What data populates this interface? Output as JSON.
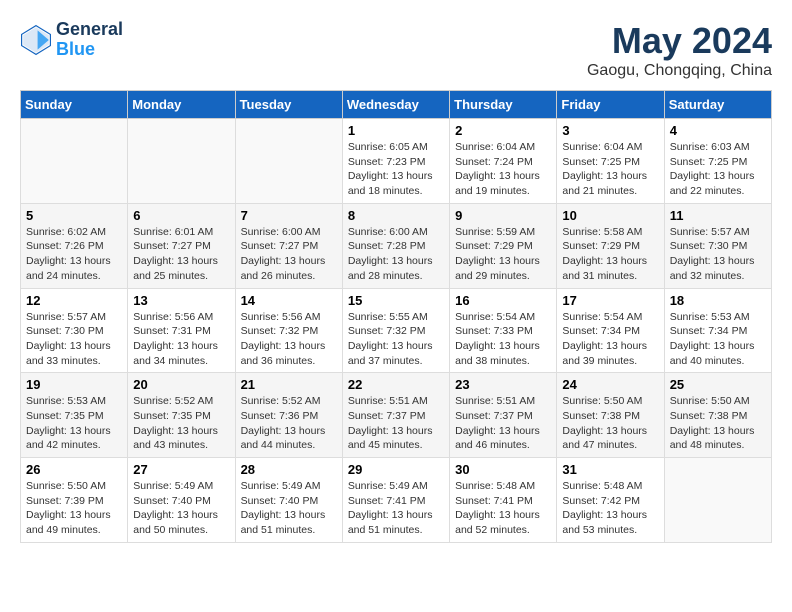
{
  "header": {
    "logo_line1": "General",
    "logo_line2": "Blue",
    "month": "May 2024",
    "location": "Gaogu, Chongqing, China"
  },
  "weekdays": [
    "Sunday",
    "Monday",
    "Tuesday",
    "Wednesday",
    "Thursday",
    "Friday",
    "Saturday"
  ],
  "weeks": [
    [
      {
        "day": "",
        "info": ""
      },
      {
        "day": "",
        "info": ""
      },
      {
        "day": "",
        "info": ""
      },
      {
        "day": "1",
        "info": "Sunrise: 6:05 AM\nSunset: 7:23 PM\nDaylight: 13 hours\nand 18 minutes."
      },
      {
        "day": "2",
        "info": "Sunrise: 6:04 AM\nSunset: 7:24 PM\nDaylight: 13 hours\nand 19 minutes."
      },
      {
        "day": "3",
        "info": "Sunrise: 6:04 AM\nSunset: 7:25 PM\nDaylight: 13 hours\nand 21 minutes."
      },
      {
        "day": "4",
        "info": "Sunrise: 6:03 AM\nSunset: 7:25 PM\nDaylight: 13 hours\nand 22 minutes."
      }
    ],
    [
      {
        "day": "5",
        "info": "Sunrise: 6:02 AM\nSunset: 7:26 PM\nDaylight: 13 hours\nand 24 minutes."
      },
      {
        "day": "6",
        "info": "Sunrise: 6:01 AM\nSunset: 7:27 PM\nDaylight: 13 hours\nand 25 minutes."
      },
      {
        "day": "7",
        "info": "Sunrise: 6:00 AM\nSunset: 7:27 PM\nDaylight: 13 hours\nand 26 minutes."
      },
      {
        "day": "8",
        "info": "Sunrise: 6:00 AM\nSunset: 7:28 PM\nDaylight: 13 hours\nand 28 minutes."
      },
      {
        "day": "9",
        "info": "Sunrise: 5:59 AM\nSunset: 7:29 PM\nDaylight: 13 hours\nand 29 minutes."
      },
      {
        "day": "10",
        "info": "Sunrise: 5:58 AM\nSunset: 7:29 PM\nDaylight: 13 hours\nand 31 minutes."
      },
      {
        "day": "11",
        "info": "Sunrise: 5:57 AM\nSunset: 7:30 PM\nDaylight: 13 hours\nand 32 minutes."
      }
    ],
    [
      {
        "day": "12",
        "info": "Sunrise: 5:57 AM\nSunset: 7:30 PM\nDaylight: 13 hours\nand 33 minutes."
      },
      {
        "day": "13",
        "info": "Sunrise: 5:56 AM\nSunset: 7:31 PM\nDaylight: 13 hours\nand 34 minutes."
      },
      {
        "day": "14",
        "info": "Sunrise: 5:56 AM\nSunset: 7:32 PM\nDaylight: 13 hours\nand 36 minutes."
      },
      {
        "day": "15",
        "info": "Sunrise: 5:55 AM\nSunset: 7:32 PM\nDaylight: 13 hours\nand 37 minutes."
      },
      {
        "day": "16",
        "info": "Sunrise: 5:54 AM\nSunset: 7:33 PM\nDaylight: 13 hours\nand 38 minutes."
      },
      {
        "day": "17",
        "info": "Sunrise: 5:54 AM\nSunset: 7:34 PM\nDaylight: 13 hours\nand 39 minutes."
      },
      {
        "day": "18",
        "info": "Sunrise: 5:53 AM\nSunset: 7:34 PM\nDaylight: 13 hours\nand 40 minutes."
      }
    ],
    [
      {
        "day": "19",
        "info": "Sunrise: 5:53 AM\nSunset: 7:35 PM\nDaylight: 13 hours\nand 42 minutes."
      },
      {
        "day": "20",
        "info": "Sunrise: 5:52 AM\nSunset: 7:35 PM\nDaylight: 13 hours\nand 43 minutes."
      },
      {
        "day": "21",
        "info": "Sunrise: 5:52 AM\nSunset: 7:36 PM\nDaylight: 13 hours\nand 44 minutes."
      },
      {
        "day": "22",
        "info": "Sunrise: 5:51 AM\nSunset: 7:37 PM\nDaylight: 13 hours\nand 45 minutes."
      },
      {
        "day": "23",
        "info": "Sunrise: 5:51 AM\nSunset: 7:37 PM\nDaylight: 13 hours\nand 46 minutes."
      },
      {
        "day": "24",
        "info": "Sunrise: 5:50 AM\nSunset: 7:38 PM\nDaylight: 13 hours\nand 47 minutes."
      },
      {
        "day": "25",
        "info": "Sunrise: 5:50 AM\nSunset: 7:38 PM\nDaylight: 13 hours\nand 48 minutes."
      }
    ],
    [
      {
        "day": "26",
        "info": "Sunrise: 5:50 AM\nSunset: 7:39 PM\nDaylight: 13 hours\nand 49 minutes."
      },
      {
        "day": "27",
        "info": "Sunrise: 5:49 AM\nSunset: 7:40 PM\nDaylight: 13 hours\nand 50 minutes."
      },
      {
        "day": "28",
        "info": "Sunrise: 5:49 AM\nSunset: 7:40 PM\nDaylight: 13 hours\nand 51 minutes."
      },
      {
        "day": "29",
        "info": "Sunrise: 5:49 AM\nSunset: 7:41 PM\nDaylight: 13 hours\nand 51 minutes."
      },
      {
        "day": "30",
        "info": "Sunrise: 5:48 AM\nSunset: 7:41 PM\nDaylight: 13 hours\nand 52 minutes."
      },
      {
        "day": "31",
        "info": "Sunrise: 5:48 AM\nSunset: 7:42 PM\nDaylight: 13 hours\nand 53 minutes."
      },
      {
        "day": "",
        "info": ""
      }
    ]
  ]
}
